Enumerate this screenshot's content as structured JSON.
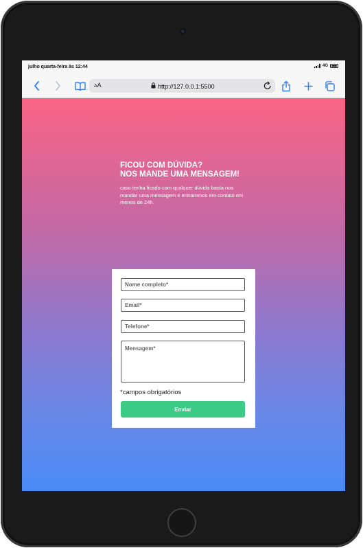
{
  "status_bar": {
    "time": "julho quarta-feira às 12:44",
    "network": "4G"
  },
  "browser": {
    "text_size_label_small": "A",
    "text_size_label_large": "A",
    "url": "http://127.0.0.1:5500"
  },
  "page": {
    "heading_line1": "FICOU COM DÚVIDA?",
    "heading_line2": "NOS MANDE UMA MENSAGEM!",
    "subtext": "caso tenha ficado com qualquer dúvida basta nos mandar uma mensagem e entraremos em contato em menos de 24h.",
    "gradient_top": "#fa6384",
    "gradient_bottom": "#4a8af7"
  },
  "form": {
    "name_placeholder": "Nome completo*",
    "email_placeholder": "Email*",
    "phone_placeholder": "Telefone*",
    "message_placeholder": "Mensagem*",
    "required_note": "*campos obrigatórios",
    "submit_label": "Enviar",
    "submit_color": "#3bcb86"
  }
}
